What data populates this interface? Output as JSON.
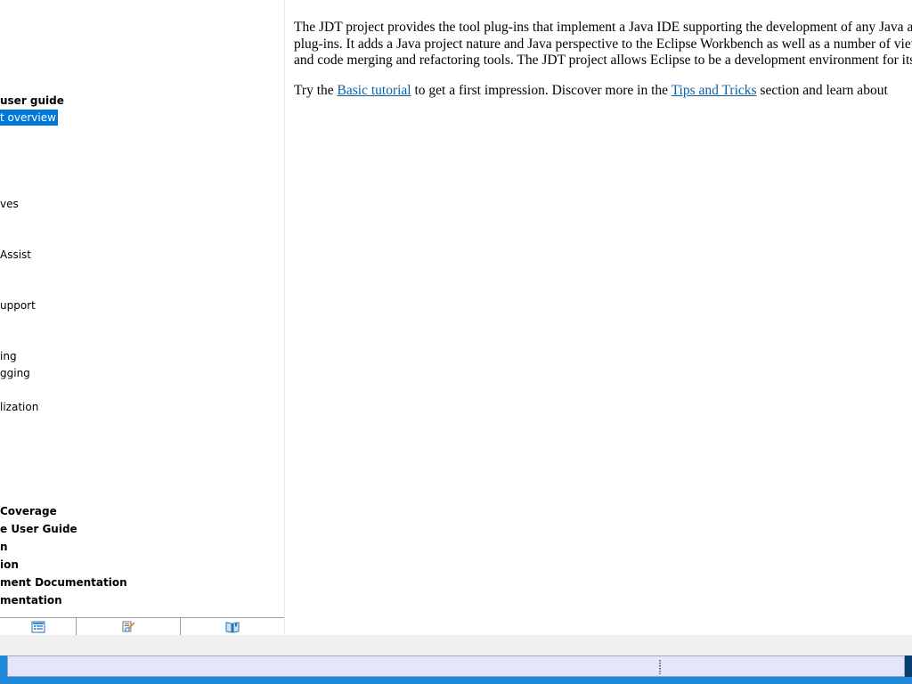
{
  "toc": {
    "items": [
      {
        "label": "user guide",
        "bold": true,
        "selected": false
      },
      {
        "label": "t overview",
        "bold": false,
        "selected": true
      },
      {
        "label": "ves",
        "bold": false,
        "selected": false
      },
      {
        "label": " Assist",
        "bold": false,
        "selected": false
      },
      {
        "label": "upport",
        "bold": false,
        "selected": false
      },
      {
        "label": "ing",
        "bold": false,
        "selected": false
      },
      {
        "label": "gging",
        "bold": false,
        "selected": false
      },
      {
        "label": "lization",
        "bold": false,
        "selected": false
      },
      {
        "label": " Coverage",
        "bold": true,
        "selected": false
      },
      {
        "label": "e User Guide",
        "bold": true,
        "selected": false
      },
      {
        "label": "n",
        "bold": true,
        "selected": false
      },
      {
        "label": "ion",
        "bold": true,
        "selected": false
      },
      {
        "label": "ment Documentation",
        "bold": true,
        "selected": false
      },
      {
        "label": "mentation",
        "bold": true,
        "selected": false
      }
    ],
    "tabs": [
      {
        "icon": "contents-icon"
      },
      {
        "icon": "search-results-icon"
      },
      {
        "icon": "bookmarks-icon"
      }
    ]
  },
  "content": {
    "paragraph1": "The JDT project provides the tool plug-ins that implement a Java IDE supporting the development of any Java application, including Eclipse plug-ins. It adds a Java project nature and Java perspective to the Eclipse Workbench as well as a number of views, editors, wizards, builders, and code merging and refactoring tools. The JDT project allows Eclipse to be a development environment for itself.",
    "paragraph2_before": "Try the ",
    "link1": "Basic tutorial",
    "paragraph2_middle": " to get a first impression. Discover more in the ",
    "link2": "Tips and Tricks",
    "paragraph2_after": " section and learn about "
  },
  "colors": {
    "selection": "#0078d7",
    "link": "#0b5fa5",
    "taskbar": "#1e88d8",
    "status_bar": "#e3e7f7"
  }
}
